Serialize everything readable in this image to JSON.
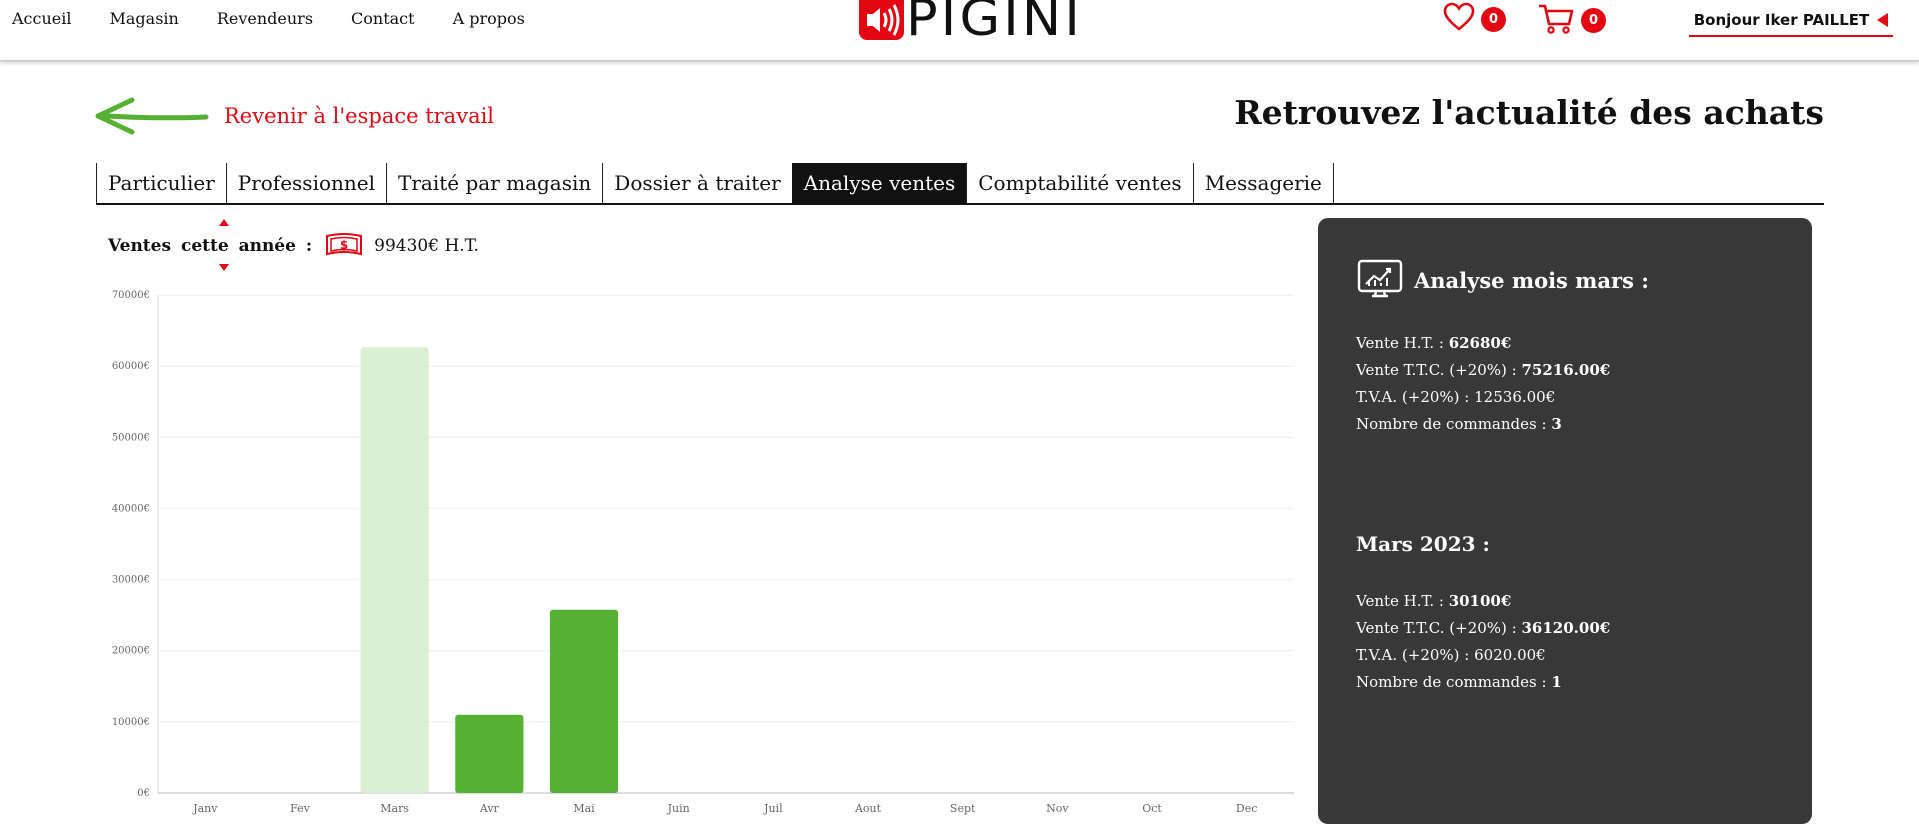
{
  "nav": {
    "items": [
      "Accueil",
      "Magasin",
      "Revendeurs",
      "Contact",
      "A propos"
    ]
  },
  "logo": {
    "text": "PIGINI"
  },
  "wishlist": {
    "icon": "heart-icon",
    "count": "0"
  },
  "cart": {
    "icon": "cart-icon",
    "count": "0"
  },
  "user": {
    "greeting": "Bonjour Iker PAILLET"
  },
  "back": {
    "label": "Revenir à l'espace travail",
    "icon": "arrow-left-icon"
  },
  "page": {
    "title": "Retrouvez l'actualité des achats"
  },
  "tabs": [
    {
      "label": "Particulier",
      "active": false
    },
    {
      "label": "Professionnel",
      "active": false
    },
    {
      "label": "Traité par magasin",
      "active": false
    },
    {
      "label": "Dossier à traiter",
      "active": false
    },
    {
      "label": "Analyse ventes",
      "active": true
    },
    {
      "label": "Comptabilité ventes",
      "active": false
    },
    {
      "label": "Messagerie",
      "active": false
    }
  ],
  "sales": {
    "label": "Ventes cette année :",
    "total": "99430€ H.T.",
    "icon": "money-icon"
  },
  "colors": {
    "accent": "#e30613",
    "bar": "#55b033",
    "bar_highlight": "#dbf0d3",
    "panel": "#383838"
  },
  "chart_data": {
    "type": "bar",
    "categories": [
      "Janv",
      "Fev",
      "Mars",
      "Avr",
      "Mai",
      "Juin",
      "Juil",
      "Aout",
      "Sept",
      "Nov",
      "Oct",
      "Dec"
    ],
    "values": [
      0,
      0,
      62680,
      11000,
      25750,
      0,
      0,
      0,
      0,
      0,
      0,
      0
    ],
    "highlighted": "Mars",
    "ylim": [
      0,
      70000
    ],
    "yticks": [
      "0€",
      "10000€",
      "20000€",
      "30000€",
      "40000€",
      "50000€",
      "60000€",
      "70000€"
    ],
    "grid": true
  },
  "panel": {
    "icon": "chart-monitor-icon",
    "month_title": "Analyse mois mars :",
    "month_stats": [
      {
        "label": "Vente H.T. :",
        "value": "62680€"
      },
      {
        "label": "Vente T.T.C. (+20%) :",
        "value": "75216.00€"
      },
      {
        "label": "T.V.A. (+20%) :",
        "value": "12536.00€"
      },
      {
        "label": "Nombre de commandes :",
        "value": "3"
      }
    ],
    "period_title": "Mars 2023 :",
    "period_stats": [
      {
        "label": "Vente H.T. :",
        "value": "30100€"
      },
      {
        "label": "Vente T.T.C. (+20%) :",
        "value": "36120.00€"
      },
      {
        "label": "T.V.A. (+20%) :",
        "value": "6020.00€"
      },
      {
        "label": "Nombre de commandes :",
        "value": "1"
      }
    ]
  }
}
